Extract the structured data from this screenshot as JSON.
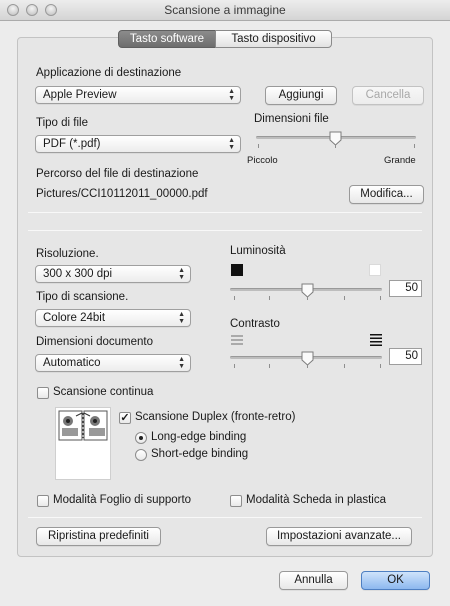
{
  "window": {
    "title": "Scansione a immagine"
  },
  "tabs": {
    "software": "Tasto software",
    "device": "Tasto dispositivo",
    "active": "software"
  },
  "destination": {
    "label": "Applicazione di destinazione",
    "app_value": "Apple Preview",
    "add_button": "Aggiungi",
    "delete_button": "Cancella"
  },
  "file_type": {
    "label": "Tipo di file",
    "value": "PDF (*.pdf)"
  },
  "file_size": {
    "label": "Dimensioni file",
    "min_label": "Piccolo",
    "max_label": "Grande",
    "level": 0.5
  },
  "path": {
    "label": "Percorso del file di destinazione",
    "value": "Pictures/CCI10112011_00000.pdf",
    "modify_button": "Modifica..."
  },
  "resolution": {
    "label": "Risoluzione.",
    "value": "300 x 300 dpi"
  },
  "scan_type": {
    "label": "Tipo di scansione.",
    "value": "Colore 24bit"
  },
  "doc_size": {
    "label": "Dimensioni documento",
    "value": "Automatico"
  },
  "brightness": {
    "label": "Luminosità",
    "value": "50",
    "level": 0.5
  },
  "contrast": {
    "label": "Contrasto",
    "value": "50",
    "level": 0.5
  },
  "continuous_scan": {
    "label": "Scansione continua",
    "checked": false
  },
  "duplex": {
    "label": "Scansione Duplex (fronte-retro)",
    "checked": true,
    "long_edge": "Long-edge binding",
    "short_edge": "Short-edge binding",
    "selected": "long"
  },
  "carrier_sheet": {
    "label": "Modalità Foglio di supporto",
    "checked": false
  },
  "plastic_card": {
    "label": "Modalità Scheda in plastica",
    "checked": false
  },
  "footer": {
    "restore_button": "Ripristina predefiniti",
    "advanced_button": "Impostazioni avanzate..."
  },
  "dialog": {
    "cancel": "Annulla",
    "ok": "OK"
  },
  "icons": [
    "close-traffic-light-icon",
    "minimize-traffic-light-icon",
    "zoom-traffic-light-icon",
    "popup-arrows-icon",
    "slider-thumb-icon",
    "black-swatch-icon",
    "white-swatch-icon",
    "low-contrast-icon",
    "high-contrast-icon",
    "duplex-pages-icon",
    "checkmark-icon"
  ]
}
